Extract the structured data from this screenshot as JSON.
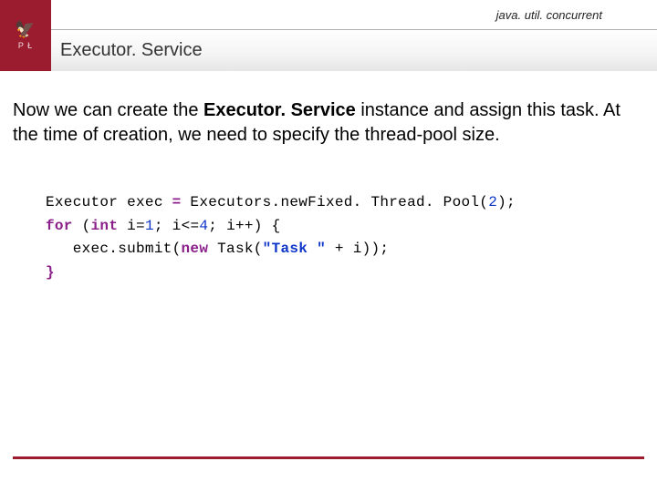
{
  "header": {
    "logo_letters": "P Ł",
    "supertitle": "java. util. concurrent",
    "title": "Executor. Service"
  },
  "body": {
    "para_pre": "Now we can create the ",
    "para_bold": "Executor. Service",
    "para_post": " instance and assign this task. At the time of creation, we need to specify the thread-pool size."
  },
  "code": {
    "l1_a": "Executor exec ",
    "l1_eq": "=",
    "l1_b": " Executors.new",
    "l1_c": "Fixed. Thread. Pool",
    "l1_open": "(",
    "l1_num": "2",
    "l1_close": ");",
    "l2_for": "for",
    "l2_sp1": " (",
    "l2_int": "int",
    "l2_sp2": " i=",
    "l2_n1": "1",
    "l2_mid": "; i<=",
    "l2_n4": "4",
    "l2_end": "; i++) {",
    "l3_a": "   exec.submit(",
    "l3_new": "new",
    "l3_sp": " Task(",
    "l3_str": "\"Task \"",
    "l3_end": " + i));",
    "l4": "}"
  }
}
